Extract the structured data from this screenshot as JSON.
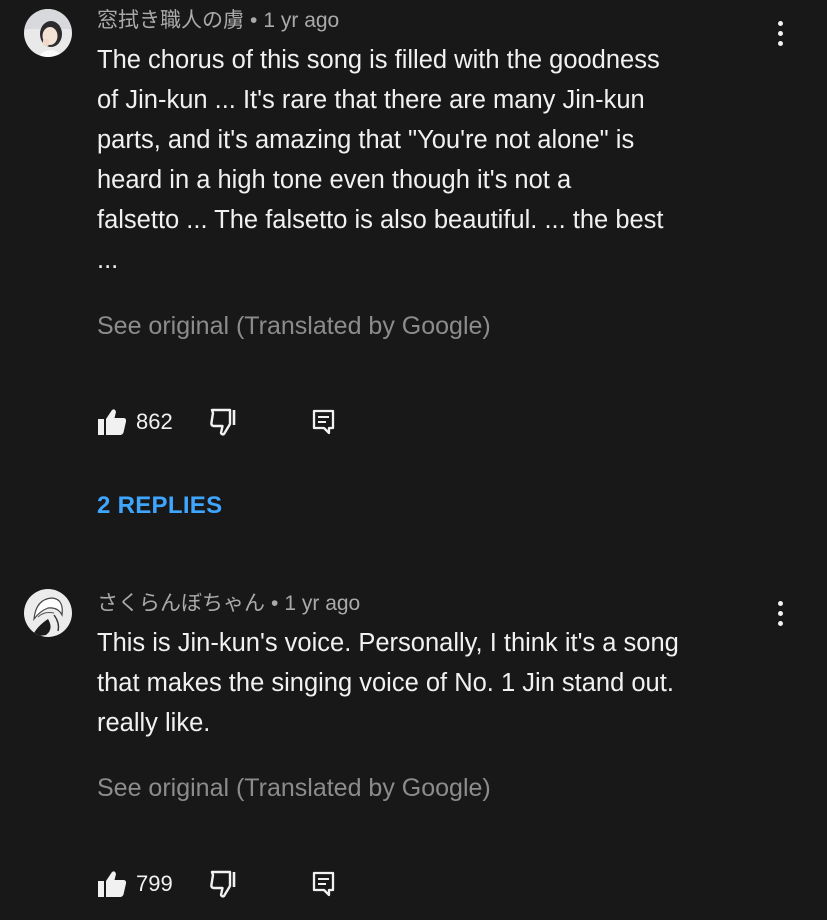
{
  "comments": [
    {
      "author": "窓拭き職人の虜",
      "separator": "•",
      "time": "1 yr ago",
      "text": "The chorus of this song is filled with the goodness\nof Jin-kun ... It's rare that there are many Jin-kun\nparts, and it's amazing that \"You're not alone\" is\nheard in a high tone even though it's not a\nfalsetto ... The falsetto is also beautiful. ... the best\n...",
      "translation_link": "See original (Translated by Google)",
      "likes": "862",
      "replies_label": "2 REPLIES",
      "avatar_icon": "user-avatar-photo",
      "more_icon": "more-vertical-icon"
    },
    {
      "author": "さくらんぼちゃん",
      "separator": "•",
      "time": "1 yr ago",
      "text": "This is Jin-kun's voice. Personally, I think it's a song\nthat makes the singing voice of No. 1 Jin stand out.\nreally like.",
      "translation_link": "See original (Translated by Google)",
      "likes": "799",
      "avatar_icon": "user-avatar-drawing",
      "more_icon": "more-vertical-icon"
    }
  ],
  "icons": {
    "like": "thumbs-up-icon",
    "dislike": "thumbs-down-icon",
    "reply": "comment-reply-icon"
  },
  "colors": {
    "background": "#181818",
    "text": "#f1f1f1",
    "muted": "#aaaaaa",
    "link": "#3ea6ff"
  }
}
